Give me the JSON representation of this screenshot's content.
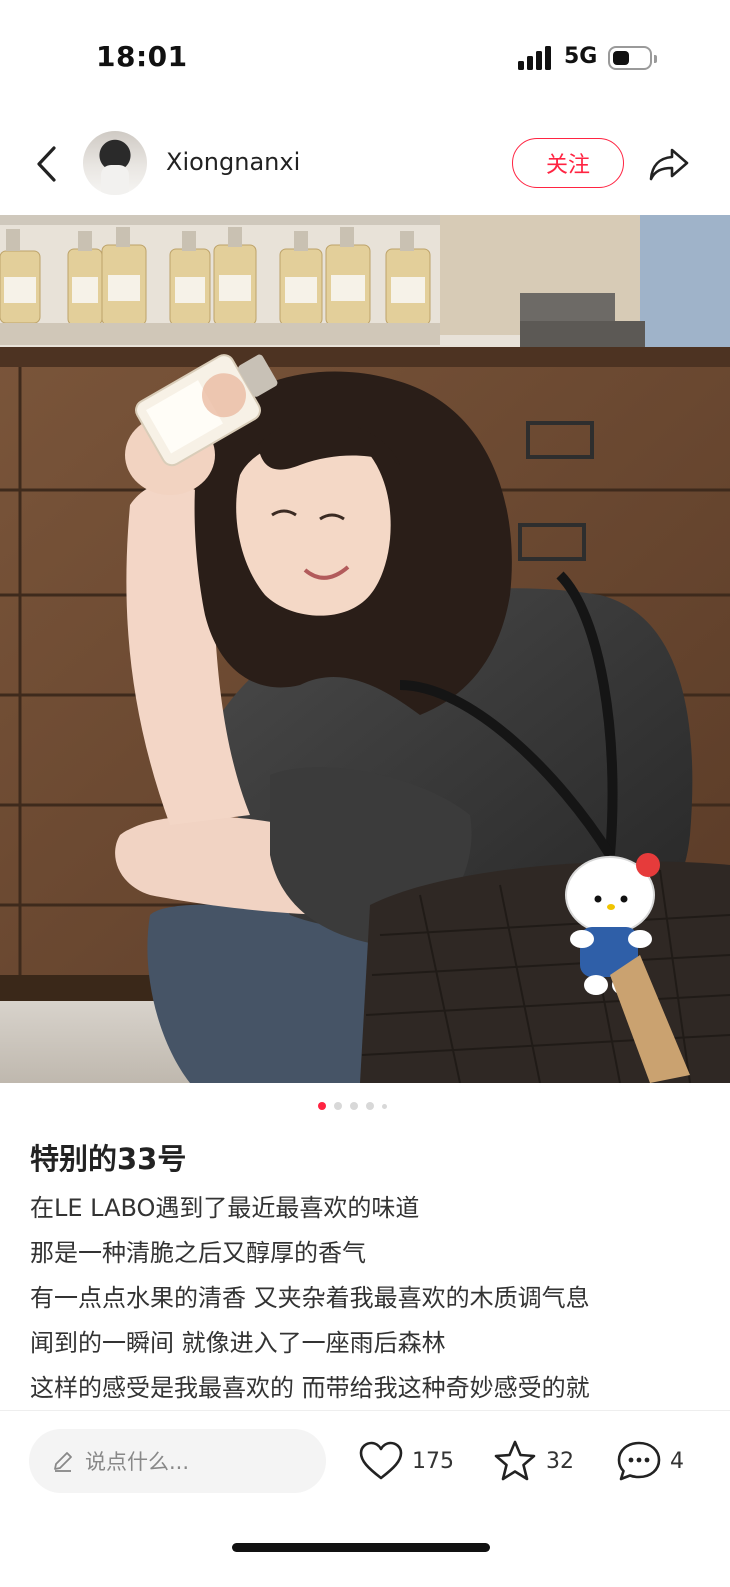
{
  "status_bar": {
    "time": "18:01",
    "network": "5G"
  },
  "header": {
    "username": "Xiongnanxi",
    "follow_label": "关注"
  },
  "carousel": {
    "count": 5,
    "active_index": 0
  },
  "post": {
    "title": "特别的33号",
    "lines": [
      "在LE LABO遇到了最近最喜欢的味道",
      "那是一种清脆之后又醇厚的香气",
      "有一点点水果的清香 又夹杂着我最喜欢的木质调气息",
      "闻到的一瞬间 就像进入了一座雨后森林",
      "这样的感受是我最喜欢的 而带给我这种奇妙感受的就"
    ]
  },
  "bottom_bar": {
    "comment_placeholder": "说点什么...",
    "likes": "175",
    "collects": "32",
    "comments": "4"
  },
  "colors": {
    "accent": "#ff2442"
  },
  "icons": [
    "back-icon",
    "share-icon",
    "pencil-icon",
    "heart-icon",
    "star-icon",
    "comment-icon"
  ]
}
